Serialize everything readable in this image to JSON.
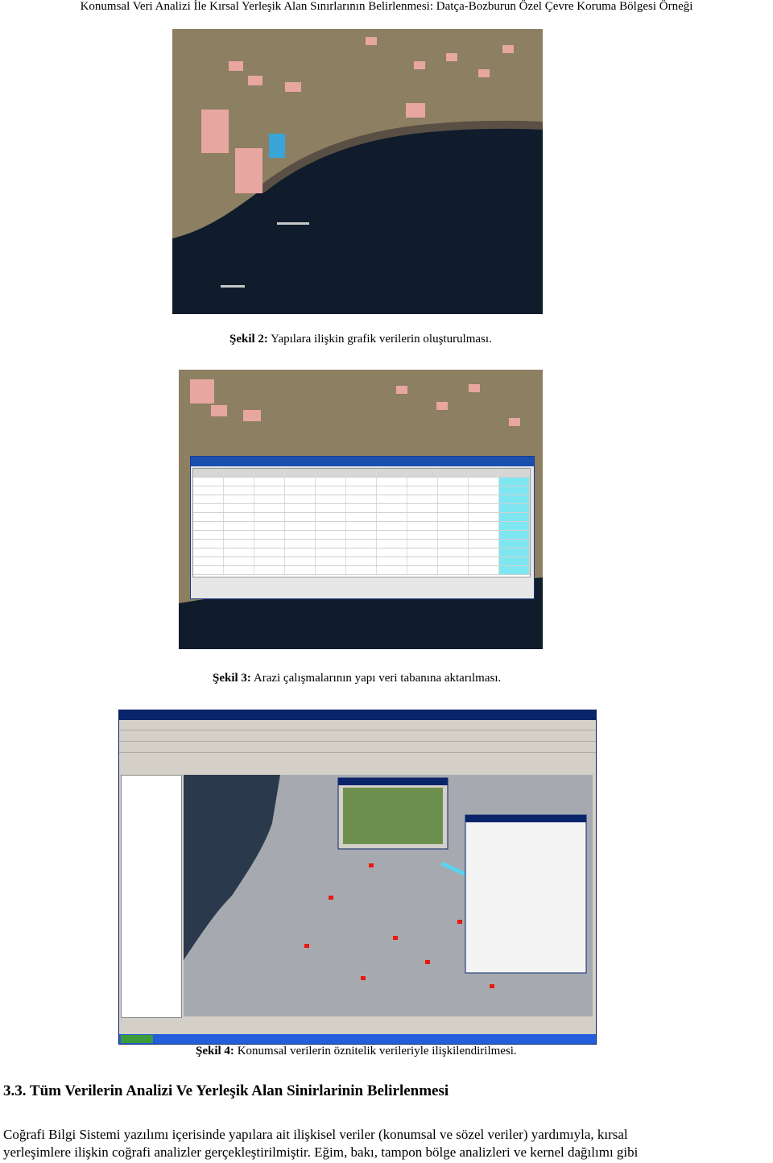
{
  "header": "Konumsal Veri Analizi İle Kırsal Yerleşik Alan Sınırlarının Belirlenmesi: Datça-Bozburun Özel Çevre Koruma Bölgesi Örneği",
  "figures": [
    {
      "label": "Şekil 2:",
      "text": "Yapılara ilişkin grafik verilerin oluşturulması."
    },
    {
      "label": "Şekil 3:",
      "text": "Arazi çalışmalarının  yapı veri tabanına aktarılması."
    },
    {
      "label": "Şekil 4:",
      "text": "Konumsal verilerin öznitelik verileriyle ilişkilendirilmesi."
    }
  ],
  "section_title": "3.3. Tüm Verilerin Analizi Ve Yerleşik Alan Sinirlarinin Belirlenmesi",
  "paragraph_lines": [
    "Coğrafi Bilgi Sistemi yazılımı   içerisinde yapılara ait ilişkisel veriler (konumsal ve sözel veriler) yardımıyla, kırsal",
    "yerleşimlere ilişkin coğrafi analizler gerçekleştirilmiştir. Eğim, bakı, tampon bölge analizleri ve kernel dağılımı gibi"
  ],
  "colors": {
    "sea": "#101c2c",
    "land": "#8d7f62",
    "building": "#e8a6a0",
    "selected": "#e8190f",
    "table_header": "#1a4fb0",
    "cyan_col": "#7ee6f0",
    "taskbar": "#245edb"
  }
}
